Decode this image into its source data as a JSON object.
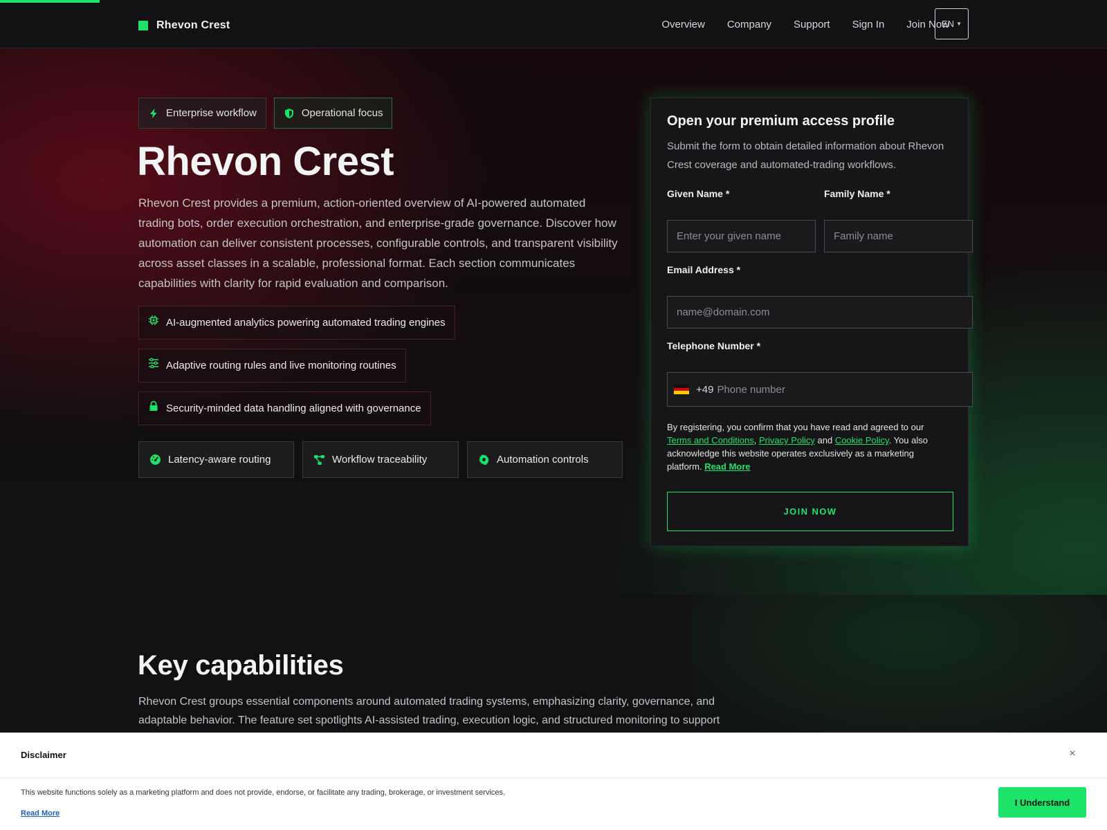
{
  "header": {
    "brand": "Rhevon Crest",
    "nav": [
      "Overview",
      "Company",
      "Support",
      "Sign In",
      "Join Now"
    ],
    "language": "EN"
  },
  "hero": {
    "chips": [
      "Enterprise workflow",
      "Operational focus"
    ],
    "title": "Rhevon Crest",
    "description": "Rhevon Crest provides a premium, action-oriented overview of AI-powered automated trading bots, order execution orchestration, and enterprise-grade governance. Discover how automation can deliver consistent processes, configurable controls, and transparent visibility across asset classes in a scalable, professional format. Each section communicates capabilities with clarity for rapid evaluation and comparison.",
    "bullets": [
      "AI-augmented analytics powering automated trading engines",
      "Adaptive routing rules and live monitoring routines",
      "Security-minded data handling aligned with governance"
    ],
    "features": [
      "Latency-aware routing",
      "Workflow traceability",
      "Automation controls"
    ]
  },
  "form": {
    "title": "Open your premium access profile",
    "subtitle": "Submit the form to obtain detailed information about Rhevon Crest coverage and automated-trading workflows.",
    "given_label": "Given Name *",
    "given_placeholder": "Enter your given name",
    "family_label": "Family Name *",
    "family_placeholder": "Family name",
    "email_label": "Email Address *",
    "email_placeholder": "name@domain.com",
    "phone_label": "Telephone Number *",
    "dial_code": "+49",
    "phone_placeholder": "Phone number",
    "consent_pre": "By registering, you confirm that you have read and agreed to our ",
    "terms": "Terms and Conditions",
    "comma": ", ",
    "privacy": "Privacy Policy",
    "and": " and ",
    "cookie": "Cookie Policy",
    "consent_post": ". You also acknowledge this website operates exclusively as a marketing platform. ",
    "read_more": "Read More",
    "submit": "JOIN NOW"
  },
  "capabilities": {
    "title": "Key capabilities",
    "description": "Rhevon Crest groups essential components around automated trading systems, emphasizing clarity, governance, and adaptable behavior. The feature set spotlights AI-assisted trading, execution logic, and structured monitoring to support"
  },
  "disclaimer": {
    "title": "Disclaimer",
    "close": "×",
    "text": "This website functions solely as a marketing platform and does not provide, endorse, or facilitate any trading, brokerage, or investment services.",
    "read_more": "Read More",
    "button": "I Understand"
  },
  "colors": {
    "accent": "#1ee36a",
    "background": "#111113"
  },
  "icons": {
    "chips": [
      "bolt-icon",
      "shield-icon"
    ],
    "bullets": [
      "chip-icon",
      "sliders-icon",
      "lock-icon"
    ],
    "features": [
      "gauge-icon",
      "flow-icon",
      "gear-icon"
    ]
  }
}
